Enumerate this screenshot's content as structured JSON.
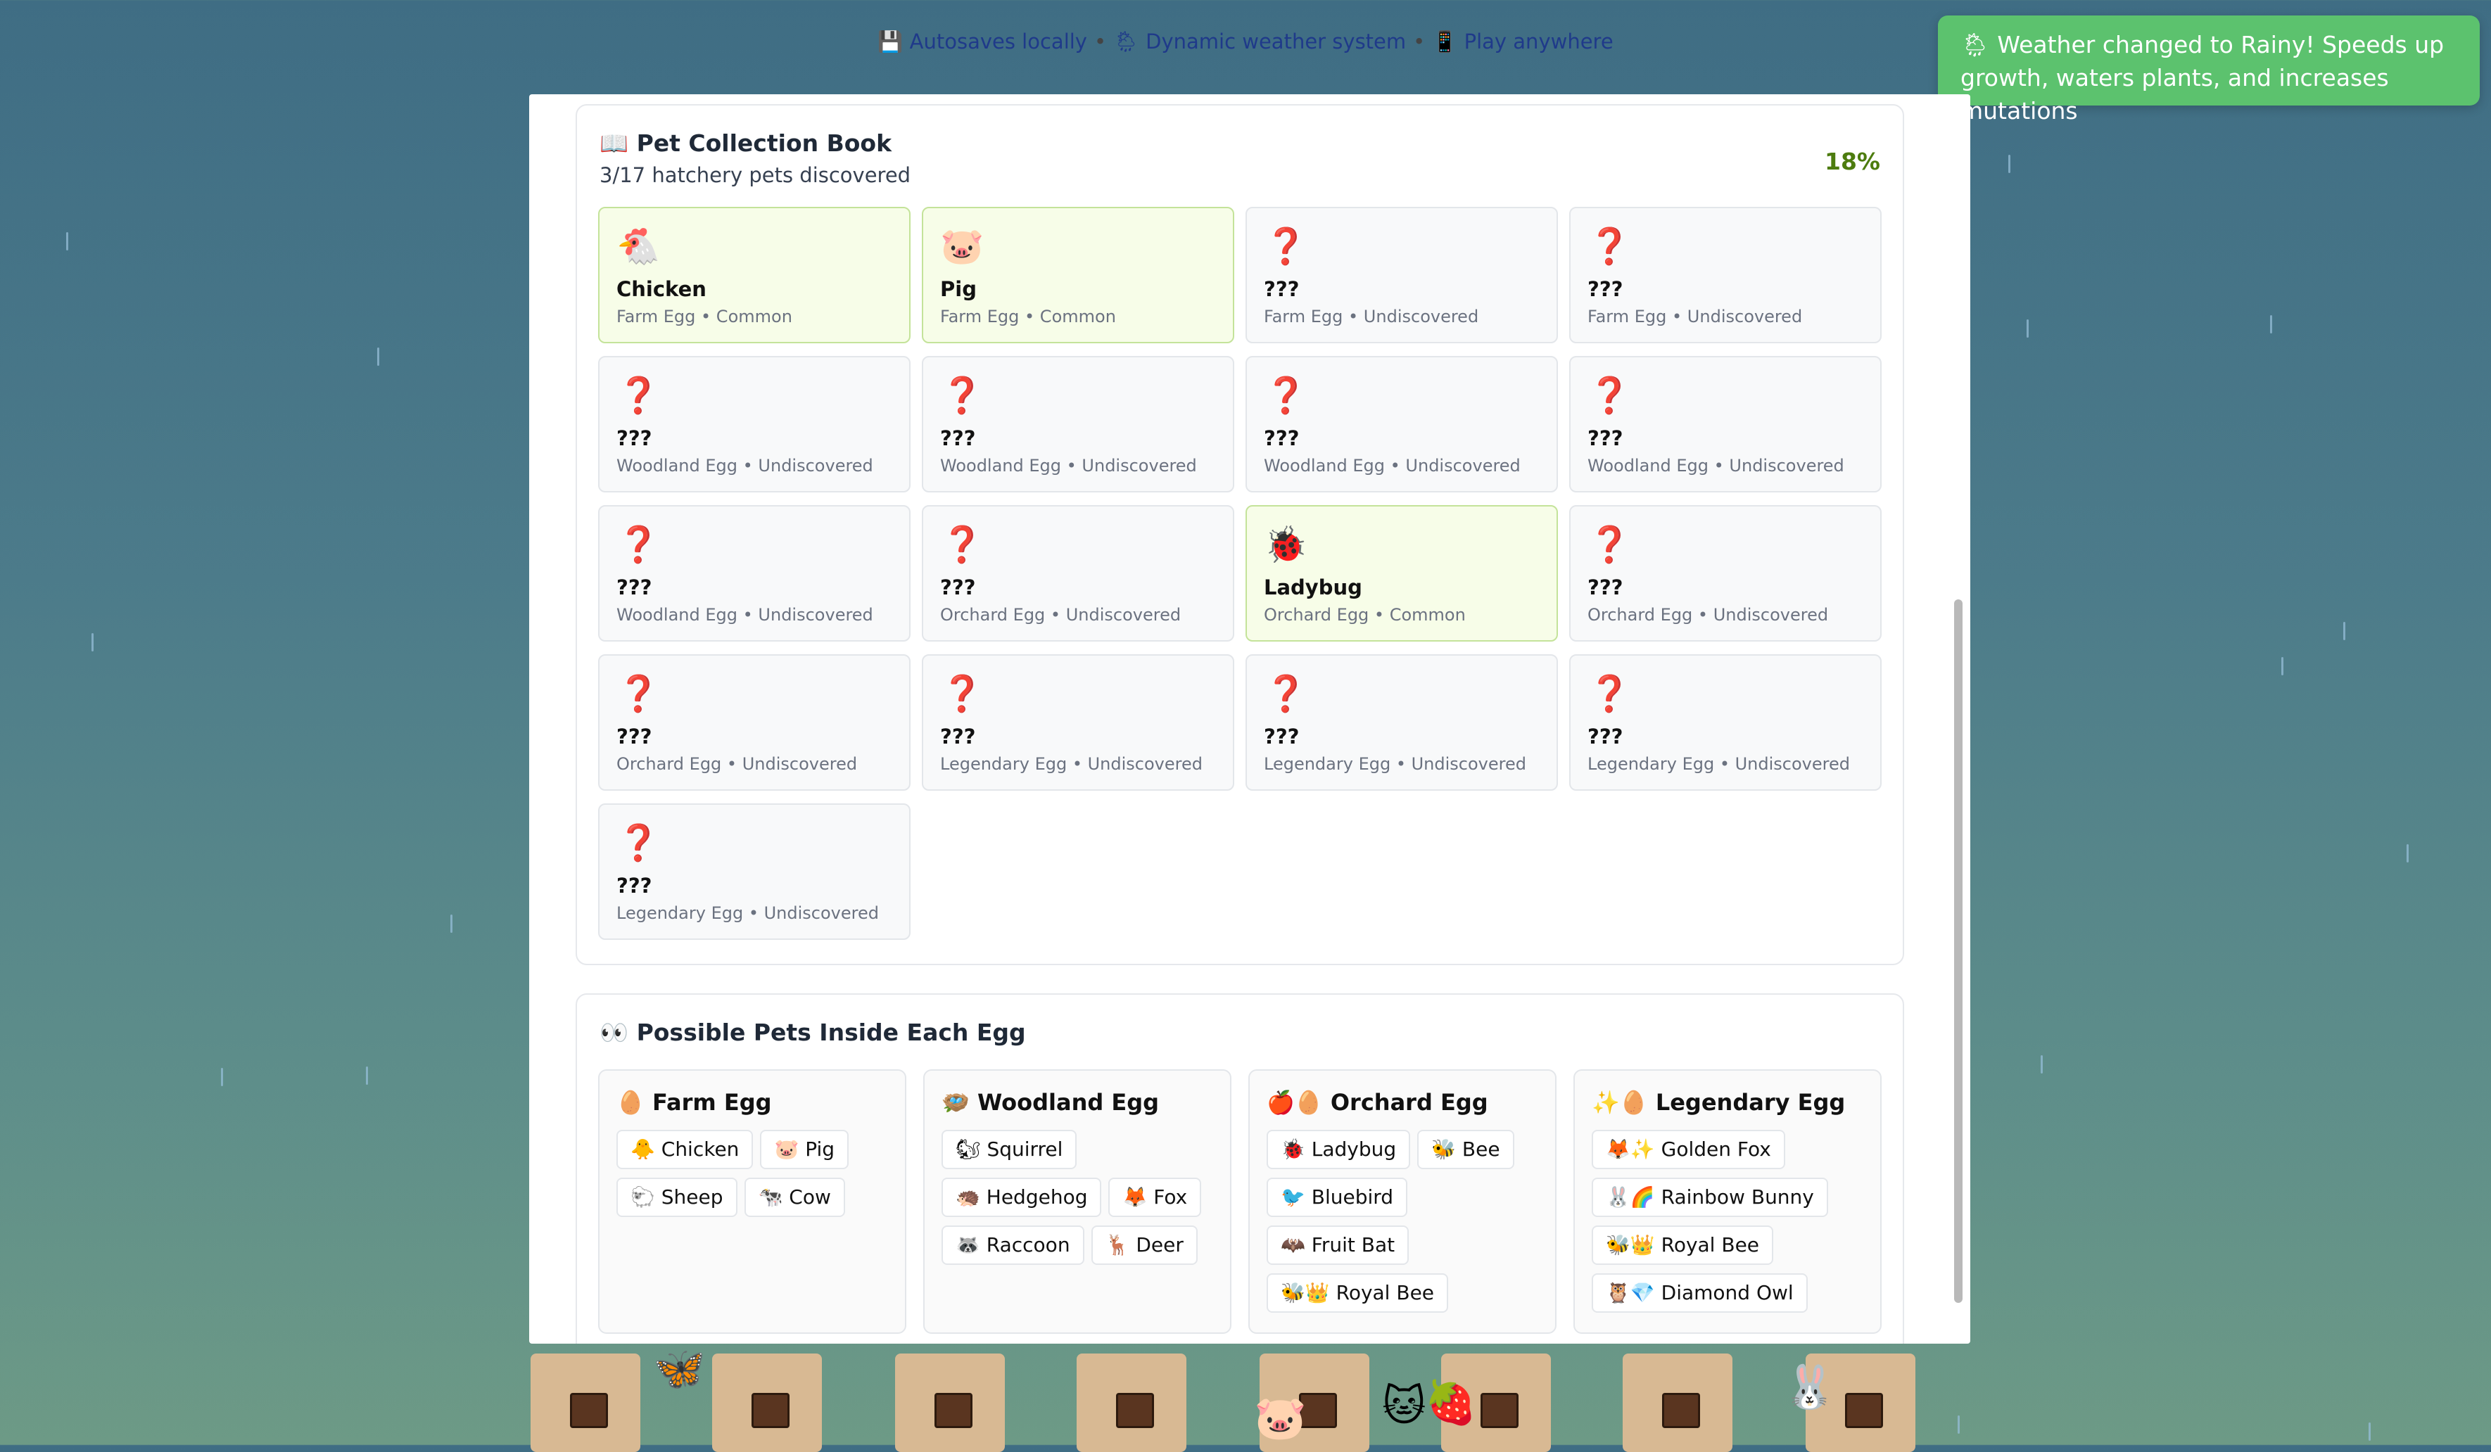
{
  "features": {
    "autosave": "💾 Autosaves locally",
    "weather": "🌦 Dynamic weather system",
    "play": "📱 Play anywhere",
    "separator": "•"
  },
  "toast": {
    "message": "🌦 Weather changed to Rainy! Speeds up growth, waters plants, and increases mutations"
  },
  "collection": {
    "title": "📖 Pet Collection Book",
    "subtitle": "3/17 hatchery pets discovered",
    "percent": "18%",
    "cells": [
      {
        "icon": "🐔",
        "name": "Chicken",
        "meta": "Farm Egg • Common",
        "found": true
      },
      {
        "icon": "🐷",
        "name": "Pig",
        "meta": "Farm Egg • Common",
        "found": true
      },
      {
        "icon": "❓",
        "name": "???",
        "meta": "Farm Egg • Undiscovered",
        "found": false
      },
      {
        "icon": "❓",
        "name": "???",
        "meta": "Farm Egg • Undiscovered",
        "found": false
      },
      {
        "icon": "❓",
        "name": "???",
        "meta": "Woodland Egg • Undiscovered",
        "found": false
      },
      {
        "icon": "❓",
        "name": "???",
        "meta": "Woodland Egg • Undiscovered",
        "found": false
      },
      {
        "icon": "❓",
        "name": "???",
        "meta": "Woodland Egg • Undiscovered",
        "found": false
      },
      {
        "icon": "❓",
        "name": "???",
        "meta": "Woodland Egg • Undiscovered",
        "found": false
      },
      {
        "icon": "❓",
        "name": "???",
        "meta": "Woodland Egg • Undiscovered",
        "found": false
      },
      {
        "icon": "❓",
        "name": "???",
        "meta": "Orchard Egg • Undiscovered",
        "found": false
      },
      {
        "icon": "🐞",
        "name": "Ladybug",
        "meta": "Orchard Egg • Common",
        "found": true
      },
      {
        "icon": "❓",
        "name": "???",
        "meta": "Orchard Egg • Undiscovered",
        "found": false
      },
      {
        "icon": "❓",
        "name": "???",
        "meta": "Orchard Egg • Undiscovered",
        "found": false
      },
      {
        "icon": "❓",
        "name": "???",
        "meta": "Legendary Egg • Undiscovered",
        "found": false
      },
      {
        "icon": "❓",
        "name": "???",
        "meta": "Legendary Egg • Undiscovered",
        "found": false
      },
      {
        "icon": "❓",
        "name": "???",
        "meta": "Legendary Egg • Undiscovered",
        "found": false
      },
      {
        "icon": "❓",
        "name": "???",
        "meta": "Legendary Egg • Undiscovered",
        "found": false
      }
    ]
  },
  "eggs": {
    "title": "👀 Possible Pets Inside Each Egg",
    "cards": [
      {
        "title": "🥚 Farm Egg",
        "pets": [
          "🐥 Chicken",
          "🐷 Pig",
          "🐑 Sheep",
          "🐄 Cow"
        ]
      },
      {
        "title": "🪺 Woodland Egg",
        "pets": [
          "🐿 Squirrel",
          "🦔 Hedgehog",
          "🦊 Fox",
          "🦝 Raccoon",
          "🦌 Deer"
        ]
      },
      {
        "title": "🍎🥚 Orchard Egg",
        "pets": [
          "🐞 Ladybug",
          "🐝 Bee",
          "🐦 Bluebird",
          "🦇 Fruit Bat",
          "🐝👑 Royal Bee"
        ]
      },
      {
        "title": "✨🥚 Legendary Egg",
        "pets": [
          "🦊✨ Golden Fox",
          "🐰🌈 Rainbow Bunny",
          "🐝👑 Royal Bee",
          "🦉💎 Diamond Owl"
        ]
      }
    ]
  },
  "garden": {
    "critters": [
      "🦋",
      "🐷",
      "🐱",
      "🍓",
      "🐰"
    ]
  },
  "colors": {
    "toast": "#5cc26e",
    "percent": "#4d7c0f",
    "found_bg": "#f7fde8",
    "unknown_icon": "#d21d1d"
  }
}
